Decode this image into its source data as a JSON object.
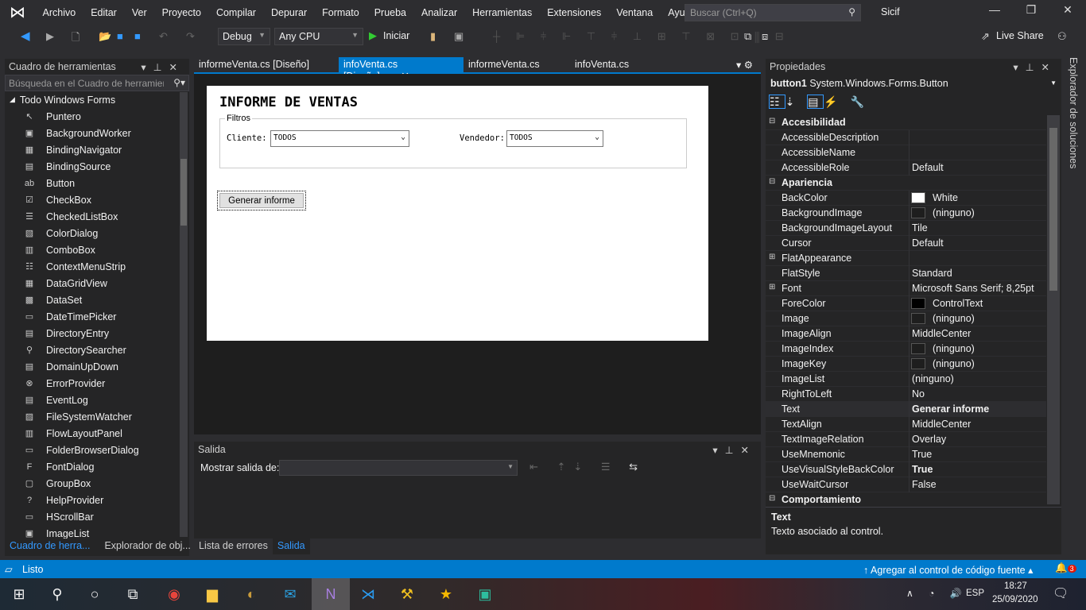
{
  "menu": [
    "Archivo",
    "Editar",
    "Ver",
    "Proyecto",
    "Compilar",
    "Depurar",
    "Formato",
    "Prueba",
    "Analizar",
    "Herramientas",
    "Extensiones",
    "Ventana",
    "Ayuda"
  ],
  "search_placeholder": "Buscar (Ctrl+Q)",
  "user": "Sicif",
  "toolbar": {
    "config": "Debug",
    "platform": "Any CPU",
    "start": "Iniciar",
    "live_share": "Live Share"
  },
  "toolbox": {
    "title": "Cuadro de herramientas",
    "search_placeholder": "Búsqueda en el Cuadro de herramientas",
    "group": "Todo Windows Forms",
    "items": [
      [
        "Puntero",
        "↖"
      ],
      [
        "BackgroundWorker",
        "▣"
      ],
      [
        "BindingNavigator",
        "▦"
      ],
      [
        "BindingSource",
        "▤"
      ],
      [
        "Button",
        "ab"
      ],
      [
        "CheckBox",
        "☑"
      ],
      [
        "CheckedListBox",
        "☰"
      ],
      [
        "ColorDialog",
        "▧"
      ],
      [
        "ComboBox",
        "▥"
      ],
      [
        "ContextMenuStrip",
        "☷"
      ],
      [
        "DataGridView",
        "▦"
      ],
      [
        "DataSet",
        "▩"
      ],
      [
        "DateTimePicker",
        "▭"
      ],
      [
        "DirectoryEntry",
        "▤"
      ],
      [
        "DirectorySearcher",
        "⚲"
      ],
      [
        "DomainUpDown",
        "▤"
      ],
      [
        "ErrorProvider",
        "⊗"
      ],
      [
        "EventLog",
        "▤"
      ],
      [
        "FileSystemWatcher",
        "▨"
      ],
      [
        "FlowLayoutPanel",
        "▥"
      ],
      [
        "FolderBrowserDialog",
        "▭"
      ],
      [
        "FontDialog",
        "F"
      ],
      [
        "GroupBox",
        "▢"
      ],
      [
        "HelpProvider",
        "?"
      ],
      [
        "HScrollBar",
        "▭"
      ],
      [
        "ImageList",
        "▣"
      ]
    ],
    "bottom_tabs": [
      "Cuadro de herra...",
      "Explorador de obj..."
    ]
  },
  "doc_tabs": [
    "informeVenta.cs [Diseño]",
    "infoVenta.cs [Diseño]",
    "informeVenta.cs",
    "infoVenta.cs"
  ],
  "form": {
    "title": "INFORME DE VENTAS",
    "group": "Filtros",
    "cliente_label": "Cliente:",
    "cliente_value": "TODOS",
    "vendedor_label": "Vendedor:",
    "vendedor_value": "TODOS",
    "button": "Generar informe"
  },
  "output": {
    "title": "Salida",
    "show_from": "Mostrar salida de:",
    "bottom_tabs": [
      "Lista de errores",
      "Salida"
    ]
  },
  "properties": {
    "title": "Propiedades",
    "object": "button1",
    "type": "System.Windows.Forms.Button",
    "rows": [
      {
        "cat": "Accesibilidad"
      },
      {
        "n": "AccessibleDescription",
        "v": ""
      },
      {
        "n": "AccessibleName",
        "v": ""
      },
      {
        "n": "AccessibleRole",
        "v": "Default"
      },
      {
        "cat": "Apariencia"
      },
      {
        "n": "BackColor",
        "v": "White",
        "sw": "#ffffff"
      },
      {
        "n": "BackgroundImage",
        "v": "(ninguno)",
        "sw": "#1e1e1e"
      },
      {
        "n": "BackgroundImageLayout",
        "v": "Tile"
      },
      {
        "n": "Cursor",
        "v": "Default"
      },
      {
        "n": "FlatAppearance",
        "v": "",
        "exp": true
      },
      {
        "n": "FlatStyle",
        "v": "Standard"
      },
      {
        "n": "Font",
        "v": "Microsoft Sans Serif; 8,25pt",
        "exp": true
      },
      {
        "n": "ForeColor",
        "v": "ControlText",
        "sw": "#000000"
      },
      {
        "n": "Image",
        "v": "(ninguno)",
        "sw": "#1e1e1e"
      },
      {
        "n": "ImageAlign",
        "v": "MiddleCenter"
      },
      {
        "n": "ImageIndex",
        "v": "(ninguno)",
        "sw": "#1e1e1e"
      },
      {
        "n": "ImageKey",
        "v": "(ninguno)",
        "sw": "#1e1e1e"
      },
      {
        "n": "ImageList",
        "v": "(ninguno)"
      },
      {
        "n": "RightToLeft",
        "v": "No"
      },
      {
        "n": "Text",
        "v": "Generar informe",
        "bold": true
      },
      {
        "n": "TextAlign",
        "v": "MiddleCenter"
      },
      {
        "n": "TextImageRelation",
        "v": "Overlay"
      },
      {
        "n": "UseMnemonic",
        "v": "True"
      },
      {
        "n": "UseVisualStyleBackColor",
        "v": "True",
        "bold": true
      },
      {
        "n": "UseWaitCursor",
        "v": "False"
      },
      {
        "cat": "Comportamiento"
      }
    ],
    "desc_title": "Text",
    "desc": "Texto asociado al control."
  },
  "solution_explorer": "Explorador de soluciones",
  "status": {
    "text": "Listo",
    "source_control": "Agregar al control de código fuente",
    "notifications": "3"
  },
  "taskbar": {
    "lang": "ESP",
    "time": "18:27",
    "date": "25/09/2020"
  },
  "colors": {
    "accent": "#007acc",
    "bg": "#2d2d30",
    "panel": "#252526"
  }
}
